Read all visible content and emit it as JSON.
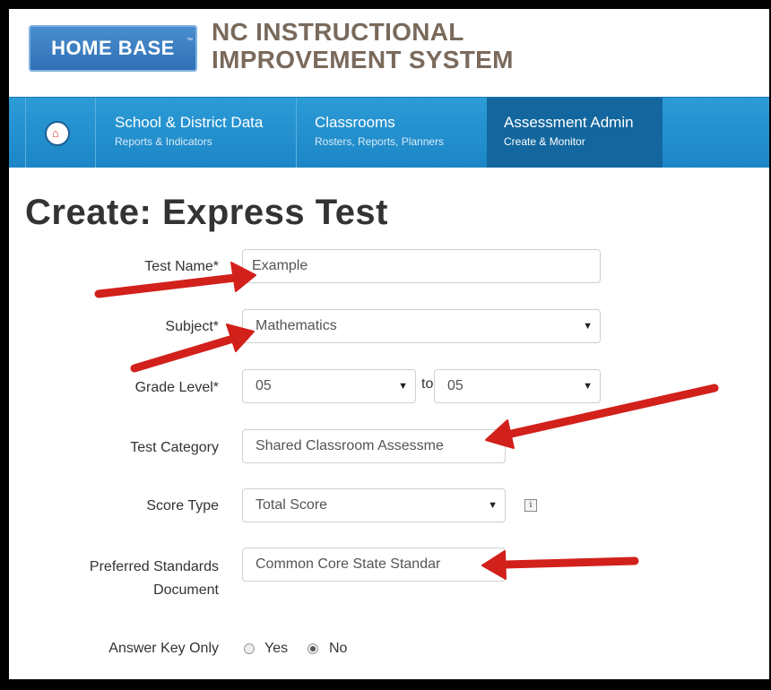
{
  "brand": {
    "logo_text": "HOME BASE",
    "logo_tm": "™",
    "title_line1": "NC INSTRUCTIONAL",
    "title_line2": "IMPROVEMENT SYSTEM"
  },
  "nav": {
    "home_icon": "home-icon",
    "items": [
      {
        "title": "School & District Data",
        "subtitle": "Reports & Indicators"
      },
      {
        "title": "Classrooms",
        "subtitle": "Rosters, Reports, Planners"
      },
      {
        "title": "Assessment Admin",
        "subtitle": "Create & Monitor",
        "active": true
      }
    ]
  },
  "page": {
    "title": "Create: Express Test"
  },
  "form": {
    "test_name": {
      "label": "Test Name*",
      "value": "Example"
    },
    "subject": {
      "label": "Subject*",
      "value": "Mathematics"
    },
    "grade_level": {
      "label": "Grade Level*",
      "from": "05",
      "to_label": "to",
      "to": "05"
    },
    "test_category": {
      "label": "Test Category",
      "value": "Shared Classroom Assessme"
    },
    "score_type": {
      "label": "Score Type",
      "value": "Total Score",
      "info_icon": "i"
    },
    "standards": {
      "label_line1": "Preferred Standards",
      "label_line2": "Document",
      "value": "Common Core State Standar"
    },
    "answer_key_only": {
      "label": "Answer Key Only",
      "yes": "Yes",
      "no": "No",
      "selected": "No"
    }
  },
  "colors": {
    "nav": "#1c86c6",
    "nav_active": "#13679e",
    "arrow": "#d2201b",
    "logo": "#3a7fc4",
    "title_brown": "#7a6a5c"
  }
}
